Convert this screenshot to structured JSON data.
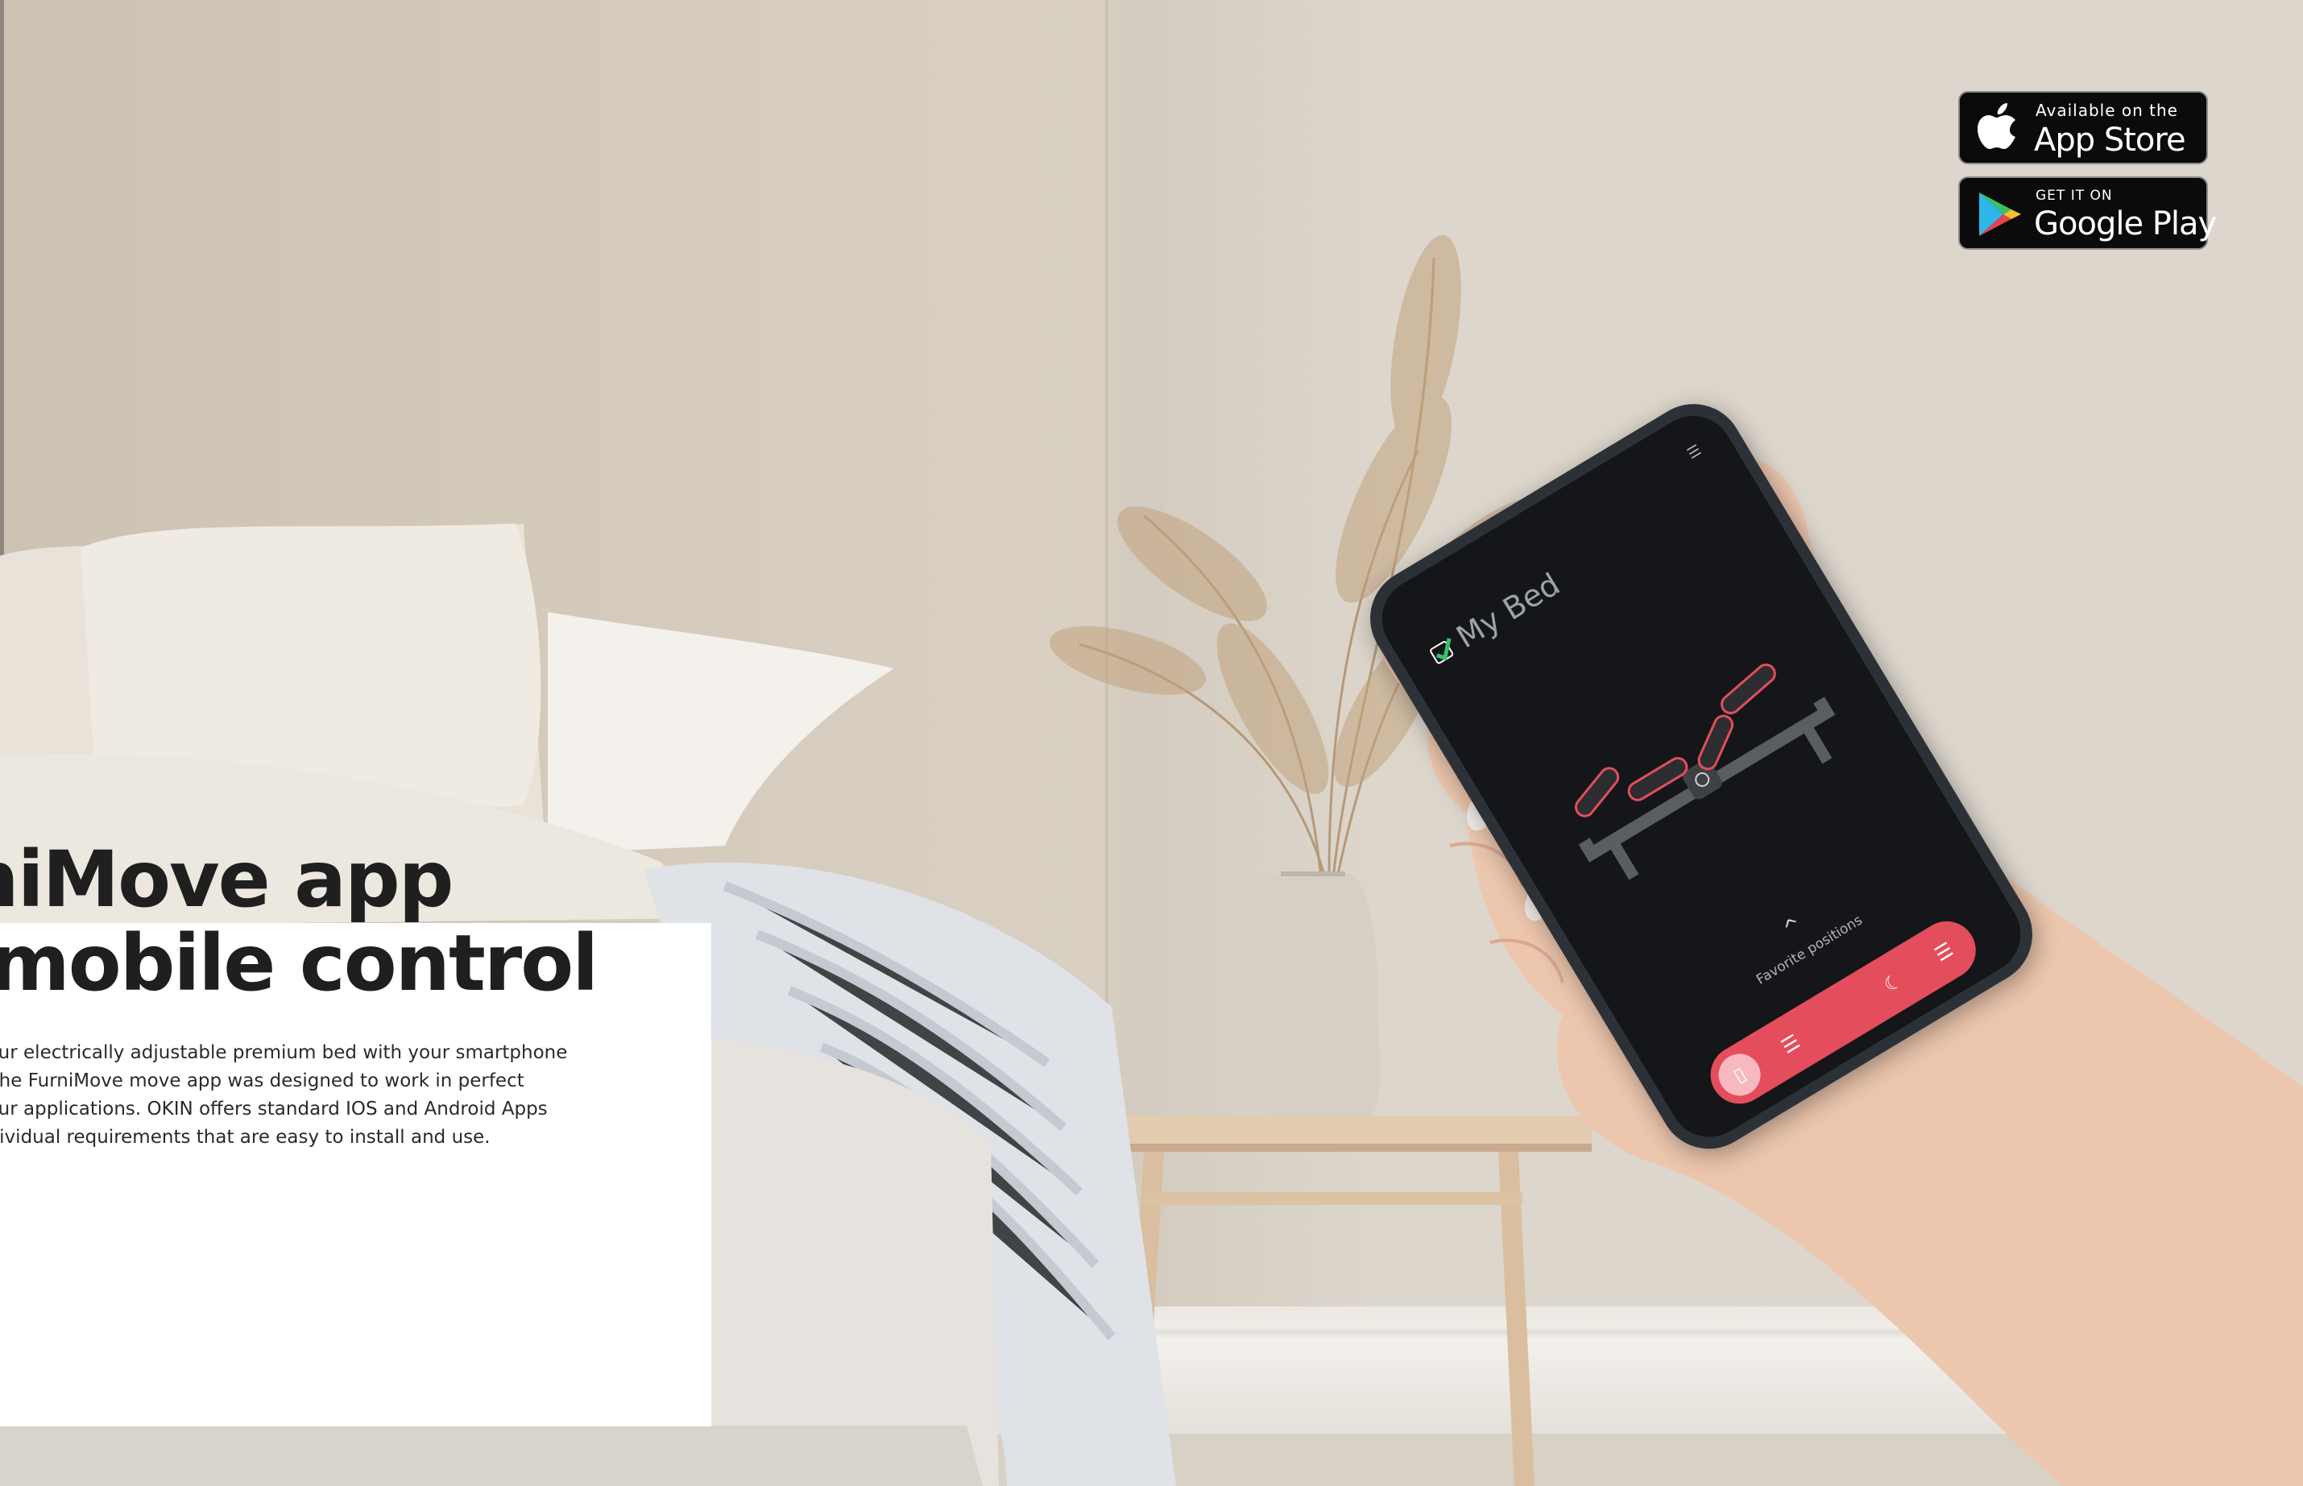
{
  "headline": {
    "line1": "rniMove app",
    "line2": "r mobile control"
  },
  "body": {
    "lines": [
      "your electrically adjustable premium bed with your smartphone",
      ". The FurniMove move app was designed to work in perfect",
      " your applications. OKIN offers standard IOS and Android Apps",
      "ndividual requirements that are easy to install and use."
    ]
  },
  "badges": {
    "apple": {
      "small": "Available on the",
      "large": "App Store",
      "icon": "apple-icon"
    },
    "google": {
      "small": "GET IT ON",
      "large": "Google Play",
      "icon": "google-play-icon"
    }
  },
  "app": {
    "title": "My Bed",
    "menu_icon": "hamburger-icon",
    "favorite_label": "Favorite positions",
    "chevron": "^",
    "accent_color": "#e44d5b",
    "tabs": [
      {
        "icon": "remote-icon",
        "glyph": "▯"
      },
      {
        "icon": "list-icon",
        "glyph": "☰"
      },
      {
        "icon": "moon-icon",
        "glyph": "☾"
      },
      {
        "icon": "menu-icon",
        "glyph": "☰"
      }
    ]
  }
}
